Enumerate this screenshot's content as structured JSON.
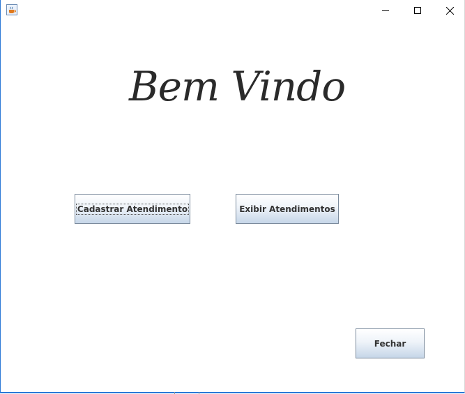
{
  "window": {
    "icon": "java-coffee-icon",
    "controls": {
      "minimize": "minimize-icon",
      "maximize": "maximize-icon",
      "close": "close-icon"
    }
  },
  "main": {
    "welcome_text": "Bem Vindo"
  },
  "buttons": {
    "cadastrar": "Cadastrar Atendimento",
    "exibir": "Exibir Atendimentos",
    "fechar": "Fechar"
  },
  "colors": {
    "accent_border": "#2b79d7",
    "button_gradient_bottom": "#c6d6e8"
  }
}
